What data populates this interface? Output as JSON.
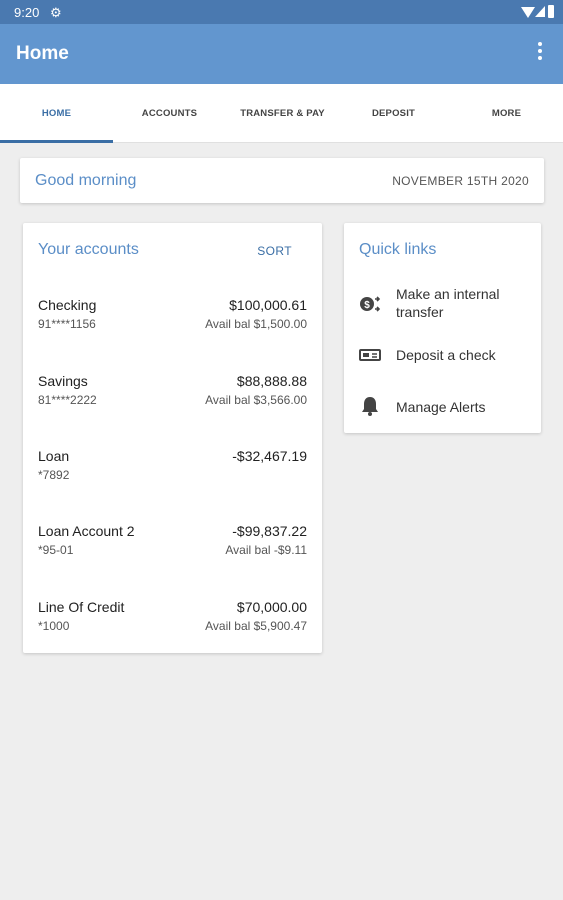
{
  "status": {
    "time": "9:20"
  },
  "appbar": {
    "title": "Home"
  },
  "tabs": [
    {
      "label": "HOME",
      "active": true
    },
    {
      "label": "ACCOUNTS"
    },
    {
      "label": "TRANSFER & PAY"
    },
    {
      "label": "DEPOSIT"
    },
    {
      "label": "MORE"
    }
  ],
  "greeting": {
    "text": "Good morning",
    "date": "NOVEMBER 15TH 2020"
  },
  "accounts": {
    "title": "Your accounts",
    "sort_label": "SORT",
    "items": [
      {
        "name": "Checking",
        "number": "91****1156",
        "balance": "$100,000.61",
        "avail": "Avail bal $1,500.00"
      },
      {
        "name": "Savings",
        "number": "81****2222",
        "balance": "$88,888.88",
        "avail": "Avail bal $3,566.00"
      },
      {
        "name": "Loan",
        "number": "*7892",
        "balance": "-$32,467.19",
        "avail": ""
      },
      {
        "name": "Loan Account 2",
        "number": "*95-01",
        "balance": "-$99,837.22",
        "avail": "Avail bal -$9.11"
      },
      {
        "name": "Line Of Credit",
        "number": "*1000",
        "balance": "$70,000.00",
        "avail": "Avail bal $5,900.47"
      }
    ]
  },
  "quick_links": {
    "title": "Quick links",
    "items": [
      {
        "label": "Make an internal transfer",
        "icon": "transfer-icon"
      },
      {
        "label": "Deposit a check",
        "icon": "check-icon"
      },
      {
        "label": "Manage Alerts",
        "icon": "bell-icon"
      }
    ]
  },
  "colors": {
    "appbar": "#6296cf",
    "statusbar": "#4a79b0",
    "accent": "#3a6ea5",
    "header_text": "#5b8ec7"
  }
}
